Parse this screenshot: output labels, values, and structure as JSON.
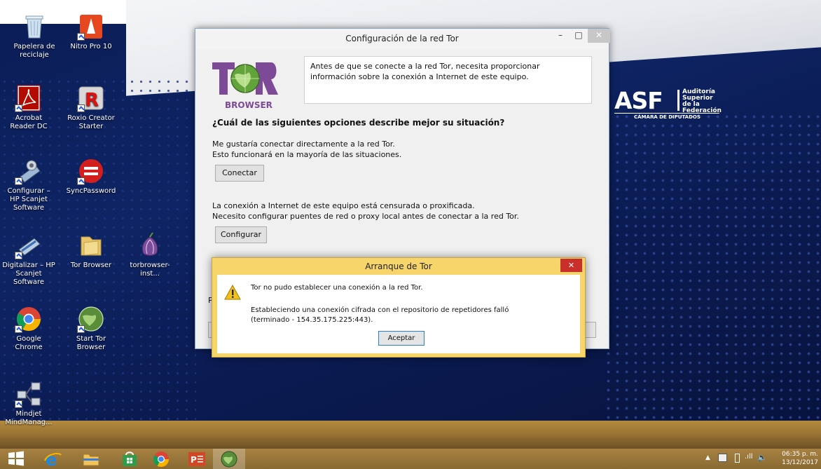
{
  "desktop": {
    "icons": [
      {
        "label": "Papelera de reciclaje",
        "icon": "recycle-bin-icon"
      },
      {
        "label": "Nitro Pro 10",
        "icon": "nitro-pro-icon"
      },
      {
        "label": "Acrobat Reader DC",
        "icon": "acrobat-reader-icon"
      },
      {
        "label": "Roxio Creator Starter",
        "icon": "roxio-creator-icon"
      },
      {
        "label": "Configurar – HP Scanjet Software",
        "icon": "hp-scanjet-config-icon"
      },
      {
        "label": "SyncPassword",
        "icon": "syncpassword-icon"
      },
      {
        "label": "Digitalizar – HP Scanjet Software",
        "icon": "hp-scanjet-scan-icon"
      },
      {
        "label": "Tor Browser",
        "icon": "folder-icon"
      },
      {
        "label": "torbrowser-inst...",
        "icon": "tor-onion-icon"
      },
      {
        "label": "Google Chrome",
        "icon": "chrome-icon"
      },
      {
        "label": "Start Tor Browser",
        "icon": "tor-globe-icon"
      },
      {
        "label": "Mindjet MindManag...",
        "icon": "mindjet-icon"
      }
    ],
    "logo": {
      "big": "ASF",
      "line1": "Auditoría",
      "line2": "Superior",
      "line3": "de la Federación",
      "sub": "CÁMARA DE DIPUTADOS"
    }
  },
  "tor_window": {
    "title": "Configuración de la red Tor",
    "logo_text": "BROWSER",
    "info": "Antes de que se conecte a la red Tor, necesita proporcionar información sobre la conexión a Internet de este equipo.",
    "question": "¿Cuál de las siguientes opciones describe mejor su situación?",
    "option1_line1": "Me gustaría conectar directamente a la red Tor.",
    "option1_line2": "Esto funcionará en la mayoría de las situaciones.",
    "connect_label": "Conectar",
    "option2_line1": "La conexión a Internet de este equipo está censurada o proxificada.",
    "option2_line2": "Necesito configurar puentes de red o proxy local antes de conectar a la red Tor.",
    "configure_label": "Configurar",
    "partial_label": "P"
  },
  "error_dialog": {
    "title": "Arranque de Tor",
    "message1": "Tor no pudo establecer una conexión a la red Tor.",
    "message2": "Estableciendo una conexión cifrada con el repositorio de repetidores falló (terminado - 154.35.175.225:443).",
    "ok_label": "Aceptar",
    "close_glyph": "✕"
  },
  "taskbar": {
    "apps": [
      "windows-start-icon",
      "internet-explorer-icon",
      "file-explorer-icon",
      "store-icon",
      "chrome-icon",
      "powerpoint-icon",
      "tor-browser-icon"
    ],
    "time": "06:35 p. m.",
    "date": "13/12/2017"
  }
}
